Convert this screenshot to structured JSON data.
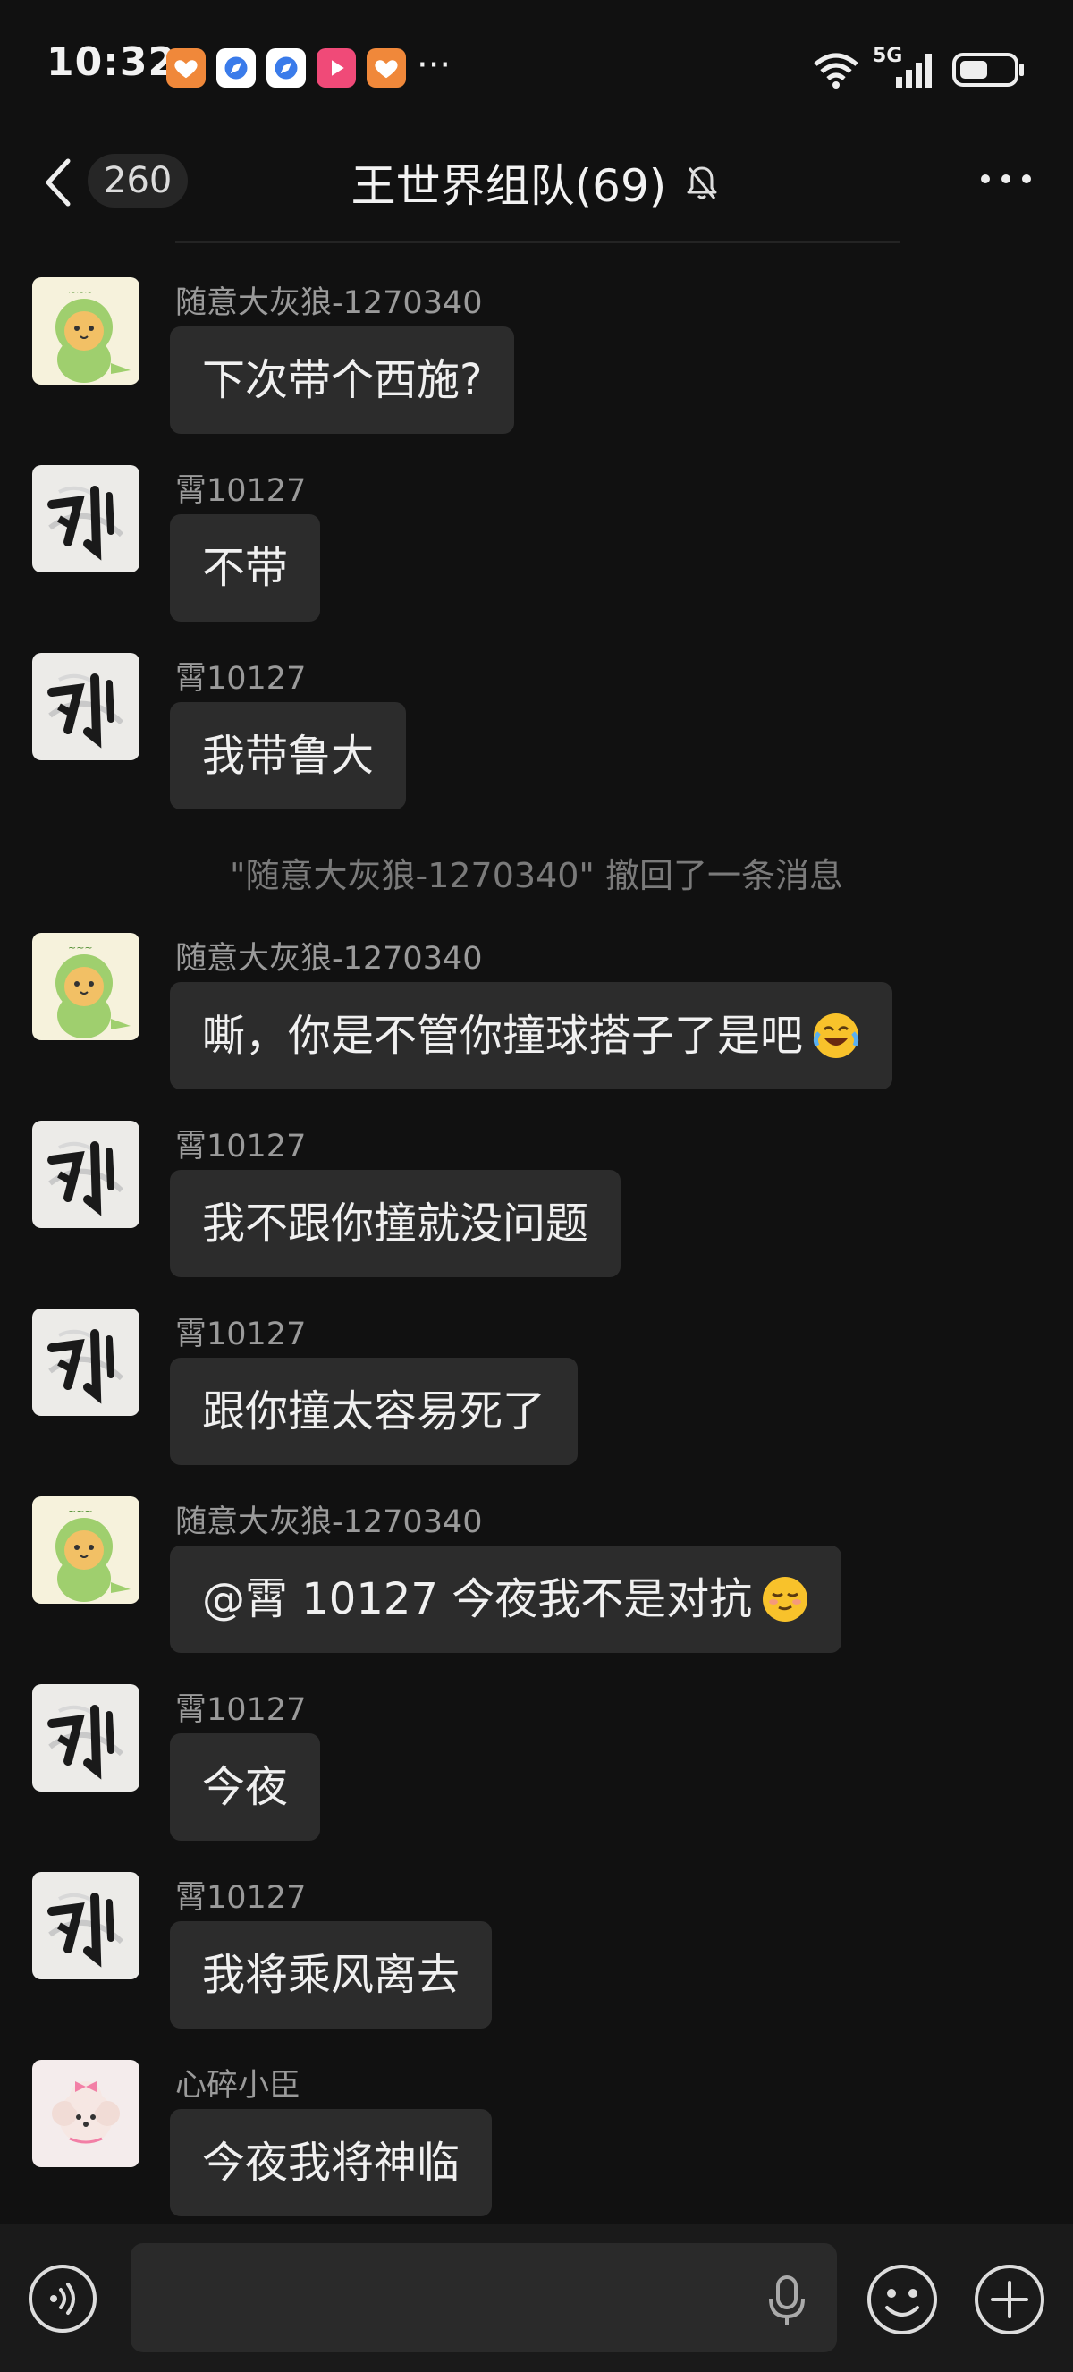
{
  "status_bar": {
    "time": "10:32",
    "network": "5G",
    "icons": [
      "app-heart-orange",
      "app-compass-blue",
      "app-compass-blue",
      "app-play-pink",
      "app-heart-orange"
    ],
    "more": "···"
  },
  "header": {
    "back_label": "<",
    "unread_count": "260",
    "title": "王世界组队(69)",
    "menu": "···"
  },
  "messages": [
    {
      "sender": "随意大灰狼-1270340",
      "text": "下次带个西施?",
      "avatar": "dino-cat"
    },
    {
      "sender": "霄10127",
      "text": "不带",
      "avatar": "calligraphy-liu"
    },
    {
      "sender": "霄10127",
      "text": "我带鲁大",
      "avatar": "calligraphy-liu"
    },
    {
      "sender": "随意大灰狼-1270340",
      "text": "嘶，你是不管你撞球搭子了是吧",
      "avatar": "dino-cat",
      "emoji": "crying-laughing"
    },
    {
      "sender": "霄10127",
      "text": "我不跟你撞就没问题",
      "avatar": "calligraphy-liu"
    },
    {
      "sender": "霄10127",
      "text": "跟你撞太容易死了",
      "avatar": "calligraphy-liu"
    },
    {
      "sender": "随意大灰狼-1270340",
      "text": "@霄 10127  今夜我不是对抗",
      "avatar": "dino-cat",
      "emoji": "smug-face"
    },
    {
      "sender": "霄10127",
      "text": "今夜",
      "avatar": "calligraphy-liu"
    },
    {
      "sender": "霄10127",
      "text": "我将乘风离去",
      "avatar": "calligraphy-liu"
    },
    {
      "sender": "心碎小臣",
      "text": "今夜我将神临",
      "avatar": "pink-poodle"
    }
  ],
  "system_message": "\"随意大灰狼-1270340\" 撤回了一条消息",
  "input": {
    "placeholder": "",
    "value": ""
  },
  "colors": {
    "background": "#111111",
    "bubble": "#2c2c2c",
    "sender": "#9a9a9a",
    "system": "#7a7a7a"
  }
}
